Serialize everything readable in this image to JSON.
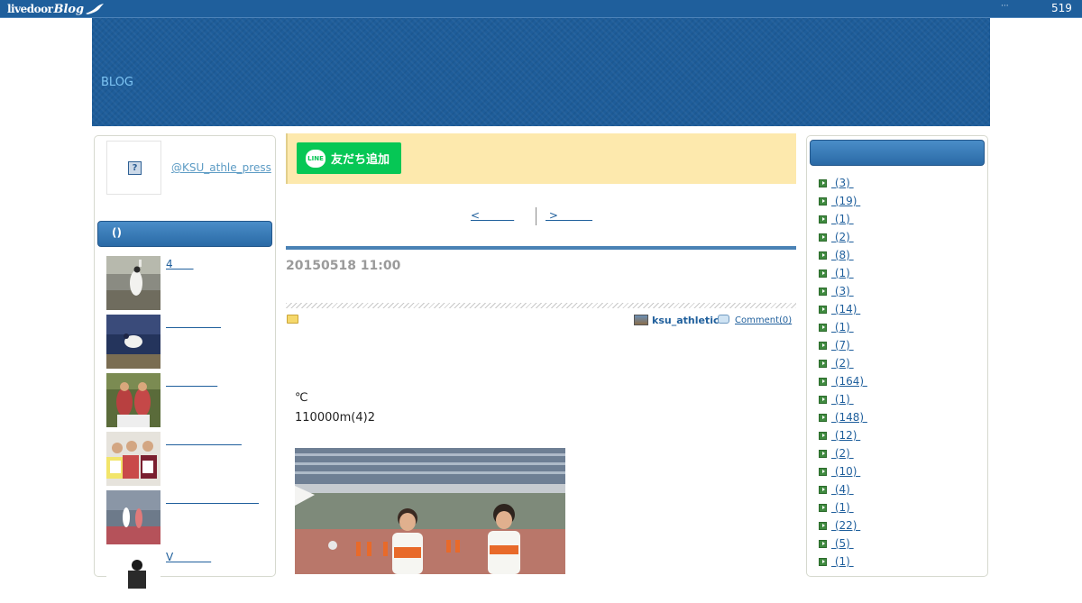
{
  "topbar": {
    "logo_text": "livedoor",
    "logo_script": "Blog",
    "dots": "···",
    "count": "519"
  },
  "header": {
    "blog_link": "BLOG"
  },
  "profile": {
    "avatar_glyph": "?",
    "twitter": "@KSU_athle_press"
  },
  "sidebar_left": {
    "heading": "()",
    "posts": [
      {
        "label": "4      "
      },
      {
        "label": "                "
      },
      {
        "label": "               "
      },
      {
        "label": "                      "
      },
      {
        "label": "                           "
      },
      {
        "label": "V           "
      }
    ]
  },
  "line": {
    "icon_text": "LINE",
    "button": "友だち追加"
  },
  "pager": {
    "prev": "<          ",
    "next": " >          "
  },
  "post": {
    "date": "20150518 11:00",
    "author": "ksu_athletic",
    "comments": "Comment(0)",
    "temp": "℃",
    "result": "110000m(4)2"
  },
  "sidebar_right": {
    "categories": [
      " (3) ",
      " (19) ",
      " (1) ",
      " (2) ",
      " (8) ",
      " (1) ",
      " (3) ",
      " (14) ",
      " (1) ",
      " (7) ",
      " (2) ",
      " (164) ",
      " (1) ",
      " (148) ",
      " (12) ",
      " (2) ",
      " (10) ",
      " (4) ",
      " (1) ",
      " (22) ",
      " (5) ",
      " (1) "
    ]
  },
  "colors": {
    "brand_blue": "#1f5f9c",
    "line_green": "#06c755",
    "notice_yellow": "#fde9ad",
    "bullet_green": "#3f8a3f"
  }
}
